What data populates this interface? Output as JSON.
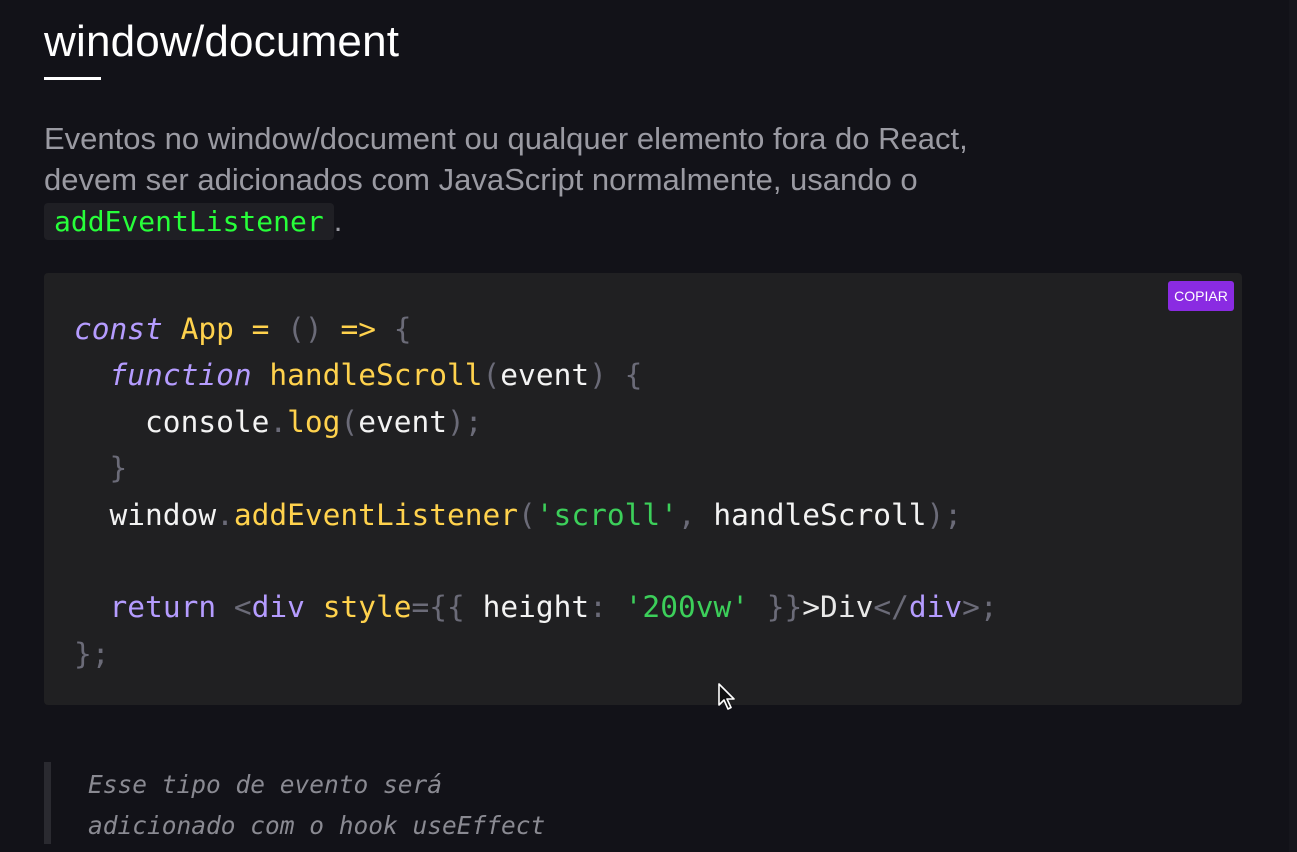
{
  "heading": {
    "title": "window/document"
  },
  "intro": {
    "text_before": "Eventos no window/document ou qualquer elemento fora do React, devem ser adicionados com JavaScript normalmente, usando o ",
    "code": "addEventListener",
    "text_after": "."
  },
  "code_block": {
    "copy_label": "COPIAR",
    "lines": [
      [
        {
          "cls": "kw",
          "t": "const"
        },
        {
          "cls": "id",
          "t": " "
        },
        {
          "cls": "fn",
          "t": "App"
        },
        {
          "cls": "id",
          "t": " "
        },
        {
          "cls": "op",
          "t": "="
        },
        {
          "cls": "id",
          "t": " "
        },
        {
          "cls": "pun",
          "t": "()"
        },
        {
          "cls": "id",
          "t": " "
        },
        {
          "cls": "op",
          "t": "=>"
        },
        {
          "cls": "id",
          "t": " "
        },
        {
          "cls": "pun",
          "t": "{"
        }
      ],
      [
        {
          "cls": "id",
          "t": "  "
        },
        {
          "cls": "kw",
          "t": "function"
        },
        {
          "cls": "id",
          "t": " "
        },
        {
          "cls": "fn",
          "t": "handleScroll"
        },
        {
          "cls": "pun",
          "t": "("
        },
        {
          "cls": "id",
          "t": "event"
        },
        {
          "cls": "pun",
          "t": ")"
        },
        {
          "cls": "id",
          "t": " "
        },
        {
          "cls": "pun",
          "t": "{"
        }
      ],
      [
        {
          "cls": "id",
          "t": "    console"
        },
        {
          "cls": "pun",
          "t": "."
        },
        {
          "cls": "fn",
          "t": "log"
        },
        {
          "cls": "pun",
          "t": "("
        },
        {
          "cls": "id",
          "t": "event"
        },
        {
          "cls": "pun",
          "t": ");"
        }
      ],
      [
        {
          "cls": "id",
          "t": "  "
        },
        {
          "cls": "pun",
          "t": "}"
        }
      ],
      [
        {
          "cls": "id",
          "t": "  window"
        },
        {
          "cls": "pun",
          "t": "."
        },
        {
          "cls": "fn",
          "t": "addEventListener"
        },
        {
          "cls": "pun",
          "t": "("
        },
        {
          "cls": "str",
          "t": "'scroll'"
        },
        {
          "cls": "pun",
          "t": ","
        },
        {
          "cls": "id",
          "t": " handleScroll"
        },
        {
          "cls": "pun",
          "t": ");"
        }
      ],
      [],
      [
        {
          "cls": "id",
          "t": "  "
        },
        {
          "cls": "kwn",
          "t": "return"
        },
        {
          "cls": "id",
          "t": " "
        },
        {
          "cls": "pun",
          "t": "<"
        },
        {
          "cls": "tag",
          "t": "div"
        },
        {
          "cls": "id",
          "t": " "
        },
        {
          "cls": "attr",
          "t": "style"
        },
        {
          "cls": "pun",
          "t": "={{"
        },
        {
          "cls": "id",
          "t": " height"
        },
        {
          "cls": "pun",
          "t": ":"
        },
        {
          "cls": "id",
          "t": " "
        },
        {
          "cls": "str",
          "t": "'200vw'"
        },
        {
          "cls": "id",
          "t": " "
        },
        {
          "cls": "pun",
          "t": "}}"
        },
        {
          "cls": "txt",
          "t": ">Div"
        },
        {
          "cls": "pun",
          "t": "</"
        },
        {
          "cls": "tag",
          "t": "div"
        },
        {
          "cls": "pun",
          "t": ">;"
        }
      ],
      [
        {
          "cls": "pun",
          "t": "};"
        }
      ]
    ]
  },
  "quote": {
    "line1": "Esse tipo de evento será",
    "line2": "adicionado com o hook useEffect"
  },
  "icons": {
    "cursor": "mouse-pointer-icon"
  }
}
